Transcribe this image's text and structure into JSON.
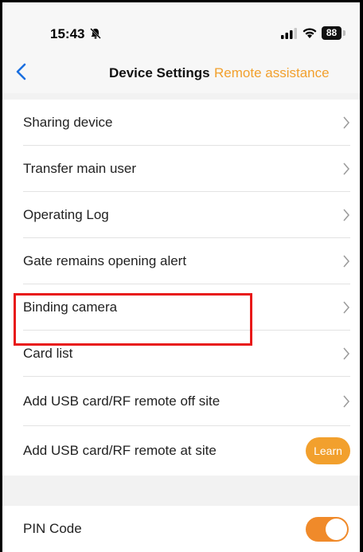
{
  "status_bar": {
    "time": "15:43",
    "battery": "88"
  },
  "nav": {
    "title": "Device Settings",
    "action": "Remote assistance"
  },
  "settings": {
    "rows": [
      {
        "label": "Sharing device"
      },
      {
        "label": "Transfer main user"
      },
      {
        "label": "Operating Log"
      },
      {
        "label": "Gate remains opening alert"
      },
      {
        "label": "Binding camera"
      },
      {
        "label": "Card list"
      },
      {
        "label": "Add USB card/RF remote off site"
      },
      {
        "label": "Add USB card/RF remote at site",
        "button": "Learn"
      }
    ]
  },
  "pin": {
    "label": "PIN Code",
    "enabled": true
  },
  "colors": {
    "accent": "#f2a02d",
    "toggle": "#f08a2a",
    "highlight": "#e81818"
  }
}
